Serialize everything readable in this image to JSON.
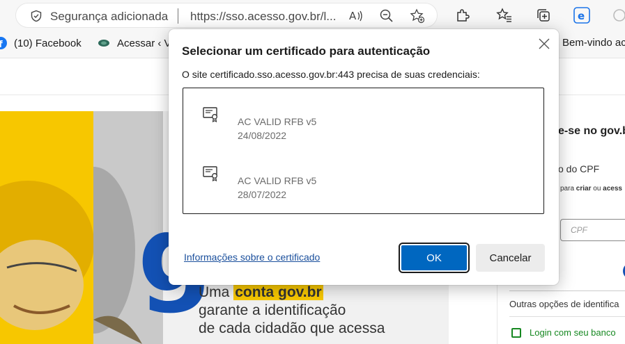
{
  "browser": {
    "security_label": "Segurança adicionada",
    "url": "https://sso.acesso.gov.br/l...",
    "icons": [
      "read-aloud-icon",
      "zoom-out-icon",
      "add-favorite-icon",
      "extensions-icon",
      "favorites-icon",
      "collections-icon",
      "edge-icon",
      "performance-icon"
    ]
  },
  "favorites": {
    "items": [
      {
        "label": "(10) Facebook",
        "icon": "facebook-icon"
      },
      {
        "label": "Acessar ‹ V",
        "icon": "site-icon"
      },
      {
        "label": "Bem-vindo ac",
        "icon": "site-icon"
      }
    ]
  },
  "page": {
    "hero_g": "g",
    "hero_text_prefix": "Uma ",
    "hero_text_highlight": "conta gov.br",
    "hero_line2": "garante a identificação",
    "hero_line3": "de cada cidadão que acessa",
    "login_title": "e-se no gov.b",
    "login_cpf": "o do CPF",
    "login_small_para": "para",
    "login_small_criar": "criar",
    "login_small_ou": "ou",
    "login_small_acess": "acess",
    "login_input_placeholder": "CPF",
    "login_other": "Outras opções de identifica",
    "login_bank": "Login com seu banco"
  },
  "dialog": {
    "title": "Selecionar um certificado para autenticação",
    "description": "O site certificado.sso.acesso.gov.br:443 precisa de suas credenciais:",
    "certificates": [
      {
        "name": "AC VALID RFB v5",
        "date": "24/08/2022"
      },
      {
        "name": "AC VALID RFB v5",
        "date": "28/07/2022"
      }
    ],
    "info_link": "Informações sobre o certificado",
    "ok_label": "OK",
    "cancel_label": "Cancelar"
  },
  "colors": {
    "accent": "#0067c0",
    "govbr_blue": "#1351b4",
    "govbr_yellow": "#f7c700",
    "link": "#1a4f9c"
  }
}
